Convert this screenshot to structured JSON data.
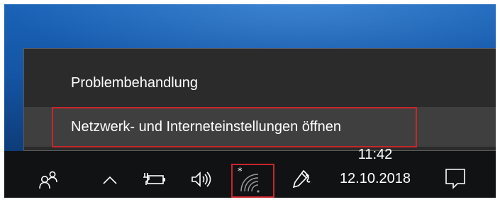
{
  "context_menu": {
    "items": [
      {
        "label": "Problembehandlung"
      },
      {
        "label": "Netzwerk- und Interneteinstellungen öffnen"
      }
    ]
  },
  "taskbar": {
    "tray_icons": [
      {
        "icon": "people-icon"
      },
      {
        "icon": "chevron-up-icon"
      },
      {
        "icon": "battery-plugged-icon"
      },
      {
        "icon": "speaker-volume-icon"
      },
      {
        "icon": "wifi-disconnected-icon"
      },
      {
        "icon": "pen-ink-icon"
      }
    ],
    "clock": {
      "time": "11:42",
      "date": "12.10.2018"
    },
    "notification_icon": "action-center-icon"
  },
  "colors": {
    "menu_bg": "#2b2b2b",
    "menu_hover": "#3f3f3f",
    "highlight_red": "#c8262b",
    "taskbar_bg": "#111214",
    "desktop_blue": "#1556a6"
  }
}
